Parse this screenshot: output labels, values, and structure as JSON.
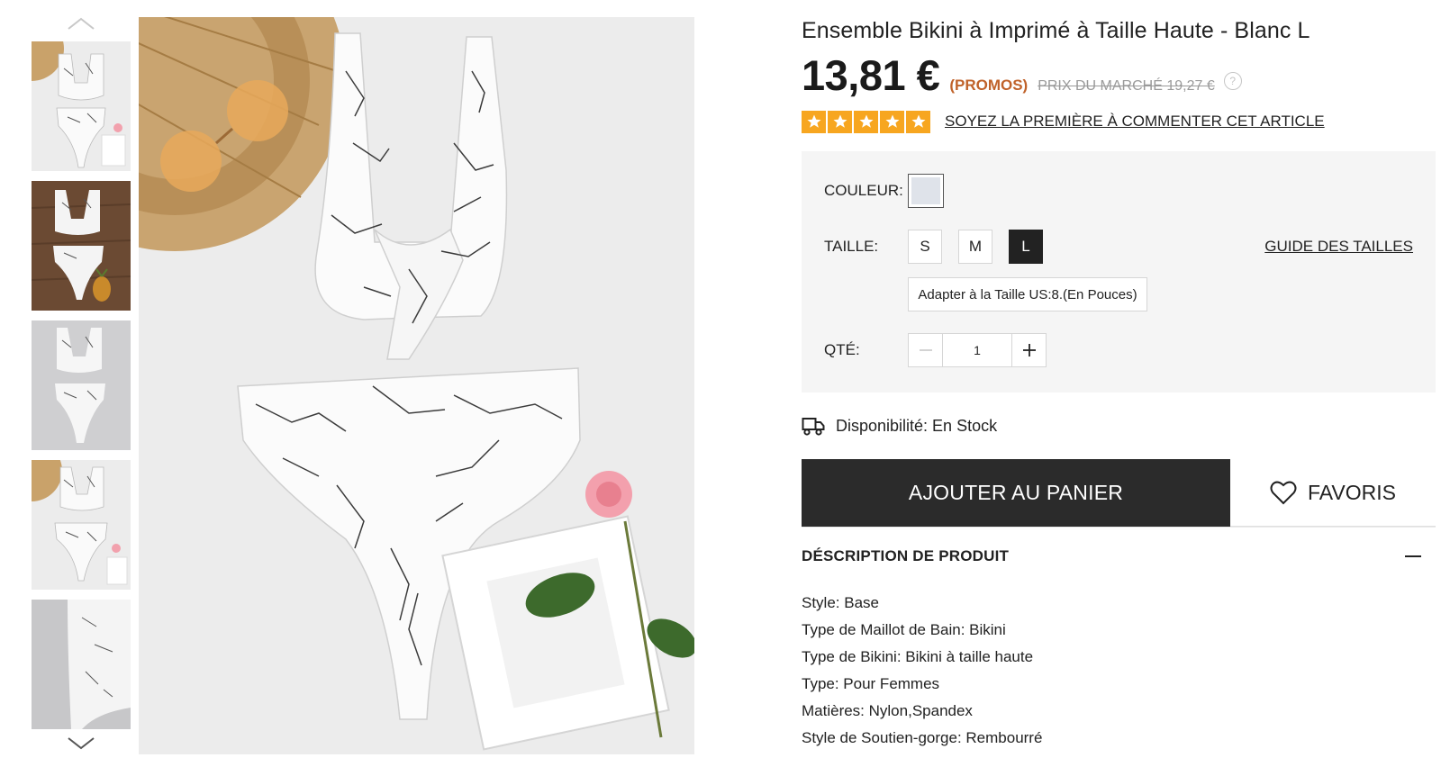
{
  "gallery": {
    "up_icon": "chevron-up-icon",
    "down_icon": "chevron-down-icon",
    "thumbnails": [
      "thumbnail-1",
      "thumbnail-2",
      "thumbnail-3",
      "thumbnail-4",
      "thumbnail-5"
    ]
  },
  "product": {
    "title": "Ensemble Bikini à Imprimé à Taille Haute - Blanc L",
    "price": "13,81 €",
    "promo_label": "(PROMOS)",
    "market_price": "PRIX DU MARCHÉ 19,27 €",
    "help_icon": "?",
    "rating_stars": 5,
    "review_link": "SOYEZ LA PREMIÈRE À COMMENTER CET ARTICLE"
  },
  "options": {
    "color_label": "COULEUR:",
    "size_label": "TAILLE:",
    "sizes": [
      "S",
      "M",
      "L"
    ],
    "selected_size": "L",
    "size_guide": "GUIDE DES TAILLES",
    "fit_note": "Adapter à la Taille US:8.(En Pouces)",
    "qty_label": "QTÉ:",
    "qty_value": "1"
  },
  "availability": {
    "icon": "delivery-truck-icon",
    "text": "Disponibilité: En Stock"
  },
  "actions": {
    "add_to_cart": "AJOUTER AU PANIER",
    "favorites": "FAVORIS"
  },
  "description": {
    "title": "DÉSCRIPTION DE PRODUIT",
    "specs": [
      "Style: Base",
      "Type de Maillot de Bain: Bikini",
      "Type de Bikini: Bikini à taille haute",
      "Type: Pour Femmes",
      "Matières: Nylon,Spandex",
      "Style de Soutien-gorge: Rembourré"
    ]
  },
  "colors": {
    "accent_star": "#f7a620",
    "promo": "#c0622a",
    "button_dark": "#2b2b2b",
    "panel_bg": "#f5f5f5"
  }
}
